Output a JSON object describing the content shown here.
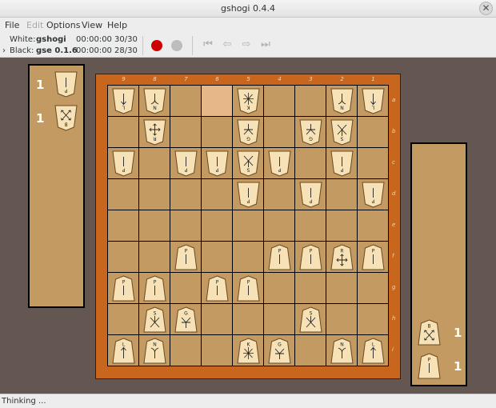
{
  "window": {
    "title": "gshogi 0.4.4",
    "close_glyph": "✕"
  },
  "menu": [
    {
      "label": "File",
      "enabled": true
    },
    {
      "label": "Edit",
      "enabled": false
    },
    {
      "label": "Options",
      "enabled": true
    },
    {
      "label": "View",
      "enabled": true
    },
    {
      "label": "Help",
      "enabled": true
    }
  ],
  "players": {
    "white": {
      "label": "White:",
      "name": "gshogi",
      "time": "00:00:00",
      "moves": "30/30"
    },
    "black": {
      "label": "Black:",
      "name": "gse 0.1.6",
      "time": "00:00:00",
      "moves": "28/30",
      "to_move_marker": "›"
    }
  },
  "toolbar": {
    "colors": {
      "record_active": "#cc0000",
      "record_inactive": "#bdbdbd"
    },
    "nav_icons": [
      "first-move-icon",
      "previous-move-icon",
      "next-move-icon",
      "last-move-icon"
    ]
  },
  "board": {
    "files": [
      "9",
      "8",
      "7",
      "6",
      "5",
      "4",
      "3",
      "2",
      "1"
    ],
    "ranks": [
      "a",
      "b",
      "c",
      "d",
      "e",
      "f",
      "g",
      "h",
      "i"
    ],
    "highlight": [
      [
        0,
        3
      ]
    ],
    "pieces": [
      {
        "r": 0,
        "c": 0,
        "k": "lance",
        "o": "w"
      },
      {
        "r": 0,
        "c": 1,
        "k": "knight",
        "o": "w"
      },
      {
        "r": 0,
        "c": 4,
        "k": "king",
        "o": "w"
      },
      {
        "r": 0,
        "c": 7,
        "k": "knight",
        "o": "w"
      },
      {
        "r": 0,
        "c": 8,
        "k": "lance",
        "o": "w"
      },
      {
        "r": 1,
        "c": 1,
        "k": "rook",
        "o": "w"
      },
      {
        "r": 1,
        "c": 4,
        "k": "gold",
        "o": "w"
      },
      {
        "r": 1,
        "c": 6,
        "k": "gold",
        "o": "w"
      },
      {
        "r": 1,
        "c": 7,
        "k": "silver",
        "o": "w"
      },
      {
        "r": 2,
        "c": 0,
        "k": "pawn",
        "o": "w"
      },
      {
        "r": 2,
        "c": 2,
        "k": "pawn",
        "o": "w"
      },
      {
        "r": 2,
        "c": 3,
        "k": "pawn",
        "o": "w"
      },
      {
        "r": 2,
        "c": 4,
        "k": "silver",
        "o": "w"
      },
      {
        "r": 2,
        "c": 5,
        "k": "pawn",
        "o": "w"
      },
      {
        "r": 2,
        "c": 7,
        "k": "pawn",
        "o": "w"
      },
      {
        "r": 3,
        "c": 4,
        "k": "pawn",
        "o": "w"
      },
      {
        "r": 3,
        "c": 6,
        "k": "pawn",
        "o": "w"
      },
      {
        "r": 3,
        "c": 8,
        "k": "pawn",
        "o": "w"
      },
      {
        "r": 5,
        "c": 2,
        "k": "pawn",
        "o": "b"
      },
      {
        "r": 5,
        "c": 5,
        "k": "pawn",
        "o": "b"
      },
      {
        "r": 5,
        "c": 6,
        "k": "pawn",
        "o": "b"
      },
      {
        "r": 5,
        "c": 7,
        "k": "rook",
        "o": "b"
      },
      {
        "r": 5,
        "c": 8,
        "k": "pawn",
        "o": "b"
      },
      {
        "r": 6,
        "c": 0,
        "k": "pawn",
        "o": "b"
      },
      {
        "r": 6,
        "c": 1,
        "k": "pawn",
        "o": "b"
      },
      {
        "r": 6,
        "c": 3,
        "k": "pawn",
        "o": "b"
      },
      {
        "r": 6,
        "c": 4,
        "k": "pawn",
        "o": "b"
      },
      {
        "r": 7,
        "c": 1,
        "k": "silver",
        "o": "b"
      },
      {
        "r": 7,
        "c": 2,
        "k": "gold",
        "o": "b"
      },
      {
        "r": 7,
        "c": 6,
        "k": "silver",
        "o": "b"
      },
      {
        "r": 8,
        "c": 0,
        "k": "lance",
        "o": "b"
      },
      {
        "r": 8,
        "c": 1,
        "k": "knight",
        "o": "b"
      },
      {
        "r": 8,
        "c": 4,
        "k": "king",
        "o": "b"
      },
      {
        "r": 8,
        "c": 5,
        "k": "gold",
        "o": "b"
      },
      {
        "r": 8,
        "c": 7,
        "k": "knight",
        "o": "b"
      },
      {
        "r": 8,
        "c": 8,
        "k": "lance",
        "o": "b"
      }
    ]
  },
  "hands": {
    "white": [
      {
        "k": "pawn",
        "count": "1"
      },
      {
        "k": "bishop",
        "count": "1"
      }
    ],
    "black": [
      {
        "k": "bishop",
        "count": "1"
      },
      {
        "k": "pawn",
        "count": "1"
      }
    ]
  },
  "piece_letters": {
    "pawn": "P",
    "lance": "L",
    "knight": "N",
    "silver": "S",
    "gold": "G",
    "bishop": "B",
    "rook": "R",
    "king": "K"
  },
  "status": {
    "text": "Thinking ..."
  }
}
